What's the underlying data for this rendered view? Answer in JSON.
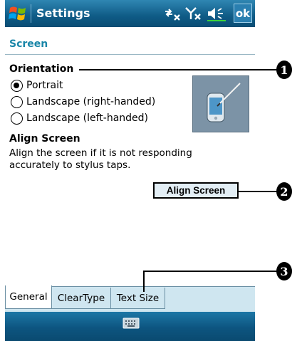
{
  "titlebar": {
    "title": "Settings",
    "ok_label": "ok"
  },
  "header": {
    "title": "Screen"
  },
  "orientation": {
    "label": "Orientation",
    "options": [
      {
        "label": "Portrait",
        "checked": true
      },
      {
        "label": "Landscape (right-handed)",
        "checked": false
      },
      {
        "label": "Landscape (left-handed)",
        "checked": false
      }
    ]
  },
  "align": {
    "heading": "Align Screen",
    "description": "Align the screen if it is not responding accurately to stylus taps.",
    "button_label": "Align Screen"
  },
  "tabs": [
    {
      "label": "General",
      "active": true
    },
    {
      "label": "ClearType",
      "active": false
    },
    {
      "label": "Text Size",
      "active": false
    }
  ],
  "callouts": [
    "1",
    "2",
    "3"
  ],
  "colors": {
    "titlebar": "#0f5b86",
    "header_text": "#1a86a8",
    "tabbar": "#cfe6f0",
    "button_bg": "#e3eef5"
  },
  "icons": [
    "windows-start-icon",
    "connectivity-icon",
    "signal-icon",
    "volume-icon",
    "keyboard-icon"
  ]
}
